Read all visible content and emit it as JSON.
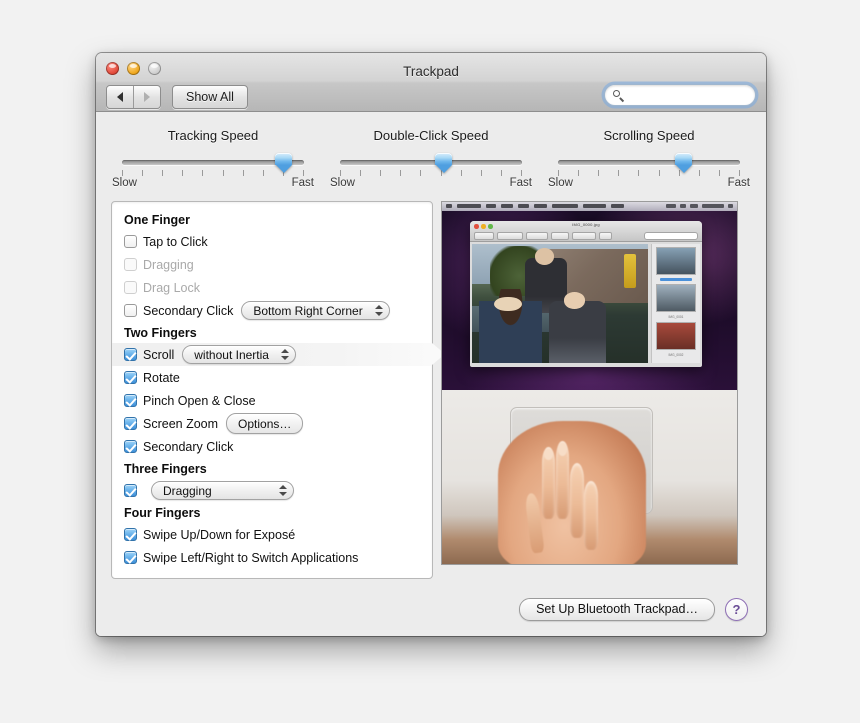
{
  "window": {
    "title": "Trackpad",
    "traffic_lights": [
      "close-button",
      "minimize-button",
      "zoom-button"
    ]
  },
  "toolbar": {
    "back_label": "◀",
    "forward_label": "▶",
    "show_all_label": "Show All",
    "search_value": "",
    "search_placeholder": ""
  },
  "sliders": [
    {
      "name": "tracking-speed",
      "title": "Tracking Speed",
      "min_label": "Slow",
      "max_label": "Fast",
      "ticks": 10,
      "value_percent": 89
    },
    {
      "name": "double-click-speed",
      "title": "Double-Click Speed",
      "min_label": "Slow",
      "max_label": "Fast",
      "ticks": 10,
      "value_percent": 57
    },
    {
      "name": "scrolling-speed",
      "title": "Scrolling Speed",
      "min_label": "Slow",
      "max_label": "Fast",
      "ticks": 10,
      "value_percent": 69
    }
  ],
  "options": {
    "groups": [
      {
        "heading": "One Finger",
        "rows": [
          {
            "label": "Tap to Click",
            "checked": false,
            "enabled": true,
            "control": null
          },
          {
            "label": "Dragging",
            "checked": false,
            "enabled": false,
            "control": null
          },
          {
            "label": "Drag Lock",
            "checked": false,
            "enabled": false,
            "control": null
          },
          {
            "label": "Secondary Click",
            "checked": false,
            "enabled": true,
            "control": {
              "type": "popup",
              "value": "Bottom Right Corner"
            }
          }
        ]
      },
      {
        "heading": "Two Fingers",
        "rows": [
          {
            "label": "Scroll",
            "checked": true,
            "enabled": true,
            "highlighted": true,
            "control": {
              "type": "popup",
              "value": "without Inertia"
            }
          },
          {
            "label": "Rotate",
            "checked": true,
            "enabled": true,
            "control": null
          },
          {
            "label": "Pinch Open & Close",
            "checked": true,
            "enabled": true,
            "control": null
          },
          {
            "label": "Screen Zoom",
            "checked": true,
            "enabled": true,
            "control": {
              "type": "button",
              "value": "Options…"
            }
          },
          {
            "label": "Secondary Click",
            "checked": true,
            "enabled": true,
            "control": null
          }
        ]
      },
      {
        "heading": "Three Fingers",
        "rows": [
          {
            "label": "",
            "checked": true,
            "enabled": true,
            "control": {
              "type": "popup",
              "value": "Dragging",
              "wide": true
            }
          }
        ]
      },
      {
        "heading": "Four Fingers",
        "rows": [
          {
            "label": "Swipe Up/Down for Exposé",
            "checked": true,
            "enabled": true,
            "control": null
          },
          {
            "label": "Swipe Left/Right to Switch Applications",
            "checked": true,
            "enabled": true,
            "control": null
          }
        ]
      }
    ]
  },
  "preview": {
    "name": "gesture-demo-video",
    "top_scene": "mac-desktop-preview-app-photo",
    "bottom_scene": "hand-two-fingers-on-trackpad"
  },
  "footer": {
    "setup_button_label": "Set Up Bluetooth Trackpad…",
    "help_label": "?"
  },
  "colors": {
    "accent_blue": "#4f9fe0",
    "help_purple": "#8e6fb5",
    "window_bg": "#ececec",
    "panel_bg": "#ffffff"
  }
}
